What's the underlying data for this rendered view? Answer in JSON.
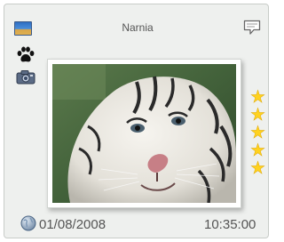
{
  "album": {
    "title": "Narnia",
    "icon": "album-photo-icon"
  },
  "icons": {
    "comment": "speech-bubble-icon",
    "paw": "paw-print-icon",
    "camera": "camera-icon",
    "globe": "globe-icon"
  },
  "photo": {
    "subject": "white tiger",
    "frame_color": "#ffffff"
  },
  "rating": {
    "stars": 5,
    "max": 5,
    "star_color": "#ffd21f"
  },
  "meta": {
    "date": "01/08/2008",
    "time": "10:35:00"
  },
  "colors": {
    "card_background": "#eef0ee",
    "text": "#555555"
  }
}
